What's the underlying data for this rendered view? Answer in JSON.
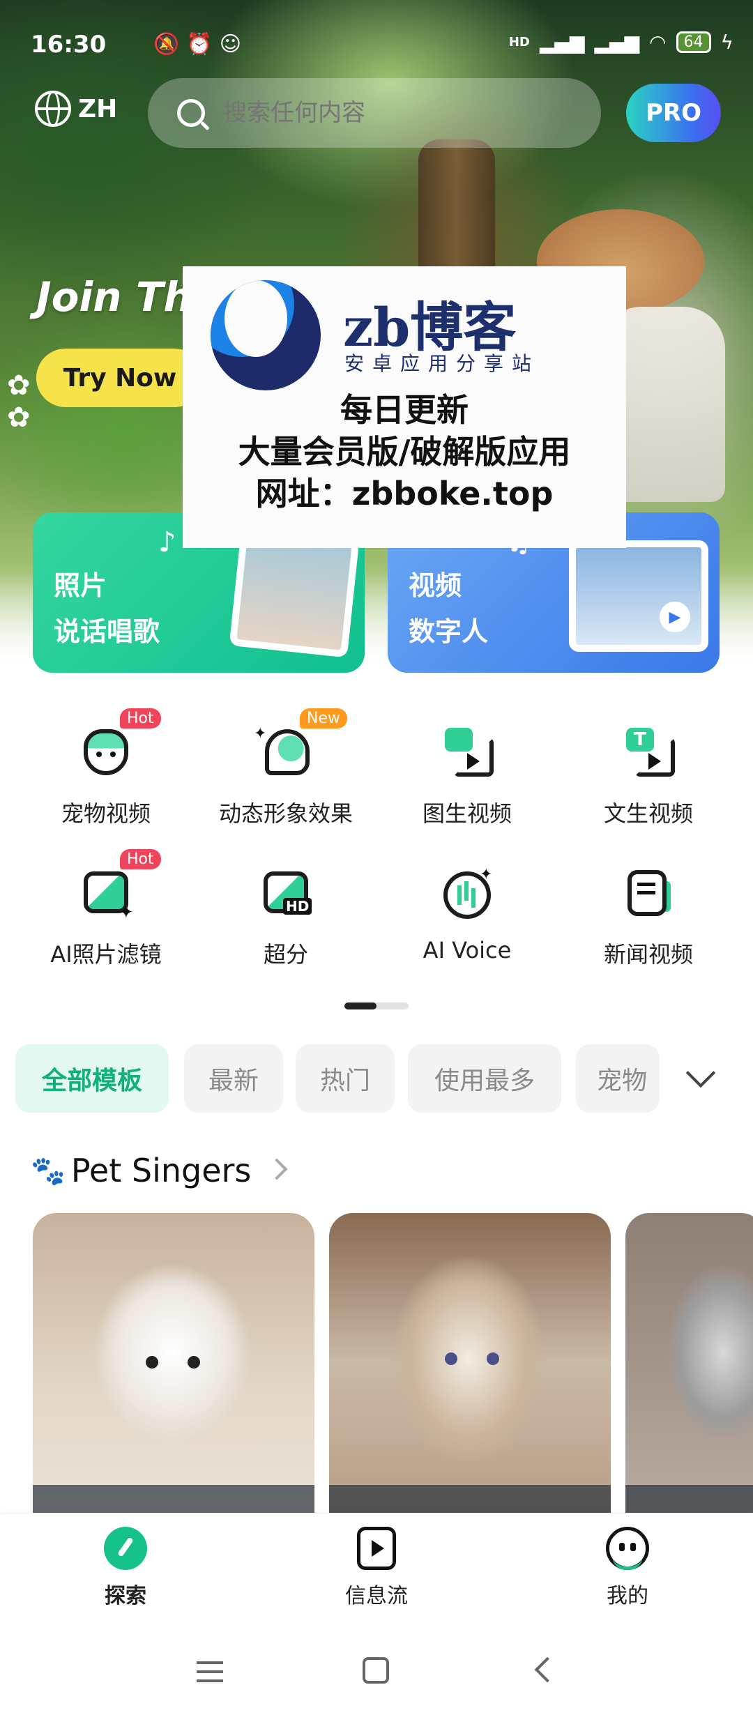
{
  "status_bar": {
    "time": "16:30",
    "battery": "64",
    "network": "HD"
  },
  "topbar": {
    "language": "ZH",
    "search_placeholder": "搜索任何内容",
    "pro_label": "PRO"
  },
  "hero": {
    "headline": "Join Th",
    "cta": "Try Now"
  },
  "watermark": {
    "brand": "zb博客",
    "subtitle": "安卓应用分享站",
    "line1": "每日更新",
    "line2": "大量会员版/破解版应用",
    "line3": "网址：zbboke.top"
  },
  "promo_cards": [
    {
      "line1": "照片",
      "line2": "说话唱歌"
    },
    {
      "line1": "视频",
      "line2": "数字人"
    }
  ],
  "tools": [
    {
      "label": "宠物视频",
      "badge": "Hot"
    },
    {
      "label": "动态形象效果",
      "badge": "New"
    },
    {
      "label": "图生视频",
      "badge": ""
    },
    {
      "label": "文生视频",
      "badge": ""
    },
    {
      "label": "AI照片滤镜",
      "badge": "Hot"
    },
    {
      "label": "超分",
      "badge": ""
    },
    {
      "label": "AI Voice",
      "badge": ""
    },
    {
      "label": "新闻视频",
      "badge": ""
    }
  ],
  "filters": [
    "全部模板",
    "最新",
    "热门",
    "使用最多",
    "宠物"
  ],
  "section": {
    "title": "Pet Singers"
  },
  "bottom_nav": [
    {
      "label": "探索",
      "active": true
    },
    {
      "label": "信息流",
      "active": false
    },
    {
      "label": "我的",
      "active": false
    }
  ],
  "colors": {
    "accent": "#15c28c",
    "hot": "#f0445a",
    "new": "#ff9a1f",
    "pro_start": "#2ad3c2",
    "pro_end": "#5a4ff0"
  }
}
